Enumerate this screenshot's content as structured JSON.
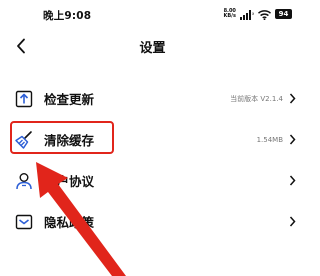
{
  "status_bar": {
    "time": "晚上9:08",
    "net_speed_value": "8.00",
    "net_speed_unit": "KB/s",
    "battery": "94"
  },
  "header": {
    "title": "设置"
  },
  "menu": {
    "items": [
      {
        "label": "检查更新",
        "value": "当前版本 V2.1.4",
        "icon": "update-icon"
      },
      {
        "label": "清除缓存",
        "value": "1.54MB",
        "icon": "broom-icon"
      },
      {
        "label": "用户协议",
        "value": "",
        "icon": "user-agreement-icon"
      },
      {
        "label": "隐私政策",
        "value": "",
        "icon": "privacy-icon"
      }
    ]
  },
  "annotation": {
    "highlight_color": "#e1251b",
    "highlighted_item": "清除缓存"
  },
  "colors": {
    "icon_blue": "#2d5fd6",
    "background": "#ffffff"
  }
}
